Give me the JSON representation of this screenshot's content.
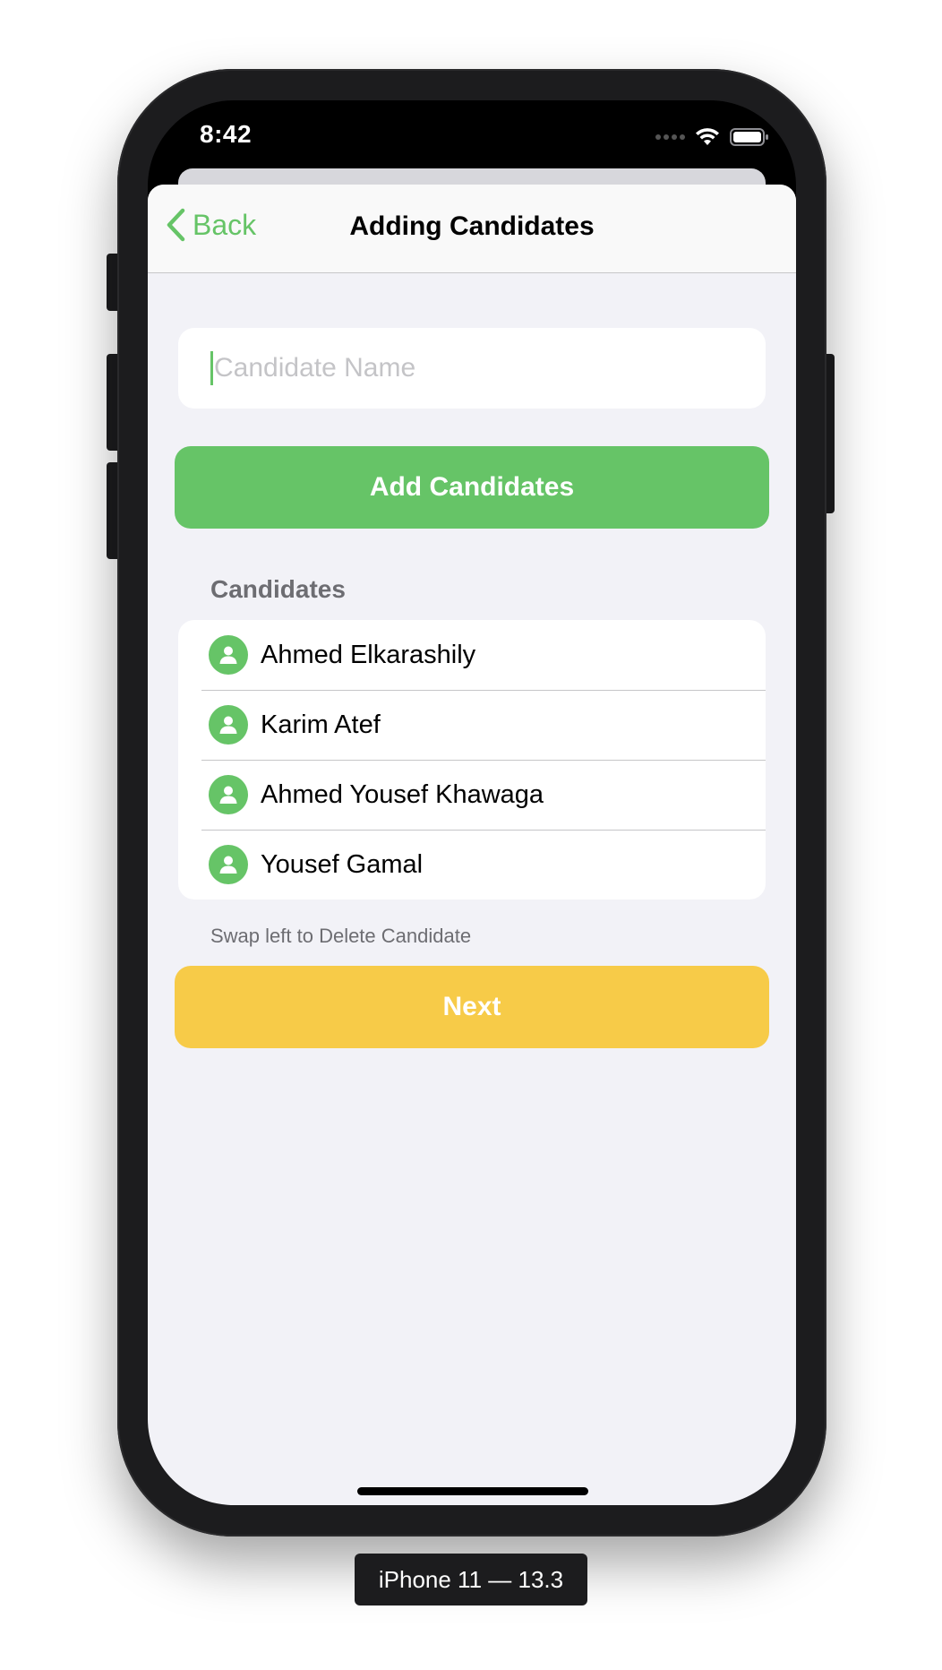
{
  "status_bar": {
    "time": "8:42"
  },
  "nav": {
    "back_label": "Back",
    "title": "Adding Candidates"
  },
  "candidate_field": {
    "placeholder": "Candidate Name",
    "value": ""
  },
  "add_button_label": "Add Candidates",
  "candidates_section": {
    "header": "Candidates",
    "items": [
      {
        "name": "Ahmed Elkarashily",
        "icon": "person-icon"
      },
      {
        "name": "Karim Atef",
        "icon": "person-icon"
      },
      {
        "name": "Ahmed Yousef Khawaga",
        "icon": "person-icon"
      },
      {
        "name": "Yousef Gamal",
        "icon": "person-icon"
      }
    ],
    "footer": "Swap left to Delete Candidate"
  },
  "next_button_label": "Next",
  "device_label": "iPhone 11 — 13.3",
  "colors": {
    "accent_green": "#66c467",
    "accent_yellow": "#f7cb48",
    "background": "#f2f2f7"
  }
}
